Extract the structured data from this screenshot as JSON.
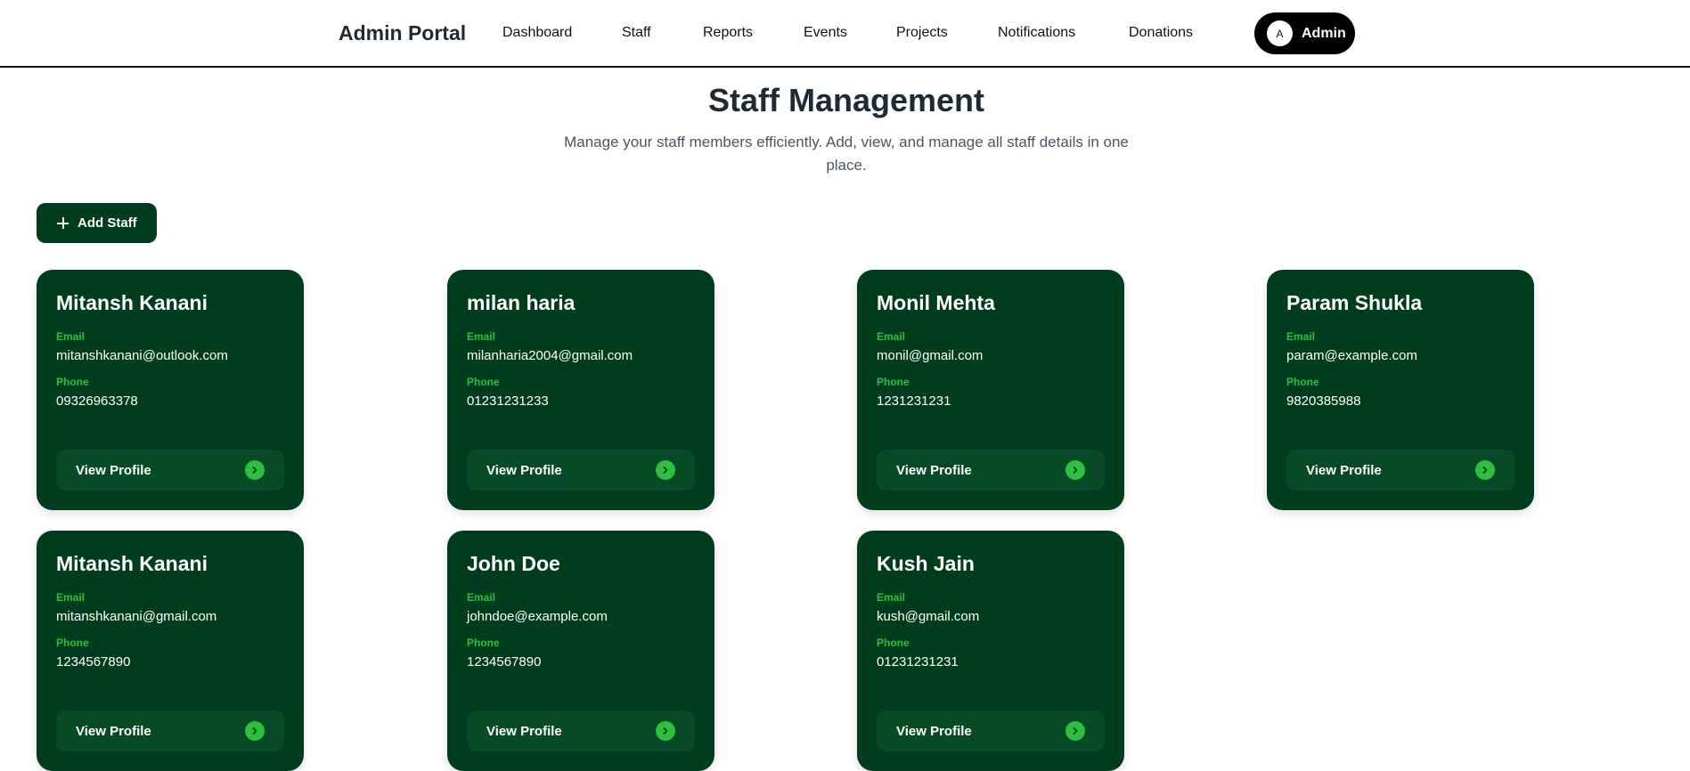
{
  "nav": {
    "brand": "Admin Portal",
    "links": [
      "Dashboard",
      "Staff",
      "Reports",
      "Events",
      "Projects",
      "Notifications",
      "Donations"
    ],
    "user_initial": "A",
    "user_name": "Admin"
  },
  "header": {
    "title": "Staff Management",
    "subtitle": "Manage your staff members efficiently. Add, view, and manage all staff details in one place."
  },
  "actions": {
    "add_label": "Add Staff"
  },
  "card_labels": {
    "email": "Email",
    "phone": "Phone",
    "view": "View Profile"
  },
  "staff": [
    {
      "name": "Mitansh Kanani",
      "email": "mitanshkanani@outlook.com",
      "phone": "09326963378"
    },
    {
      "name": "milan haria",
      "email": "milanharia2004@gmail.com",
      "phone": "01231231233"
    },
    {
      "name": "Monil Mehta",
      "email": "monil@gmail.com",
      "phone": "1231231231"
    },
    {
      "name": "Param Shukla",
      "email": "param@example.com",
      "phone": "9820385988"
    },
    {
      "name": "Mitansh Kanani",
      "email": "mitanshkanani@gmail.com",
      "phone": "1234567890"
    },
    {
      "name": "John Doe",
      "email": "johndoe@example.com",
      "phone": "1234567890"
    },
    {
      "name": "Kush Jain",
      "email": "kush@gmail.com",
      "phone": "01231231231"
    }
  ],
  "colors": {
    "card_bg": "#003d1f",
    "accent_green": "#2fbf3f",
    "nav_pill": "#000000"
  }
}
